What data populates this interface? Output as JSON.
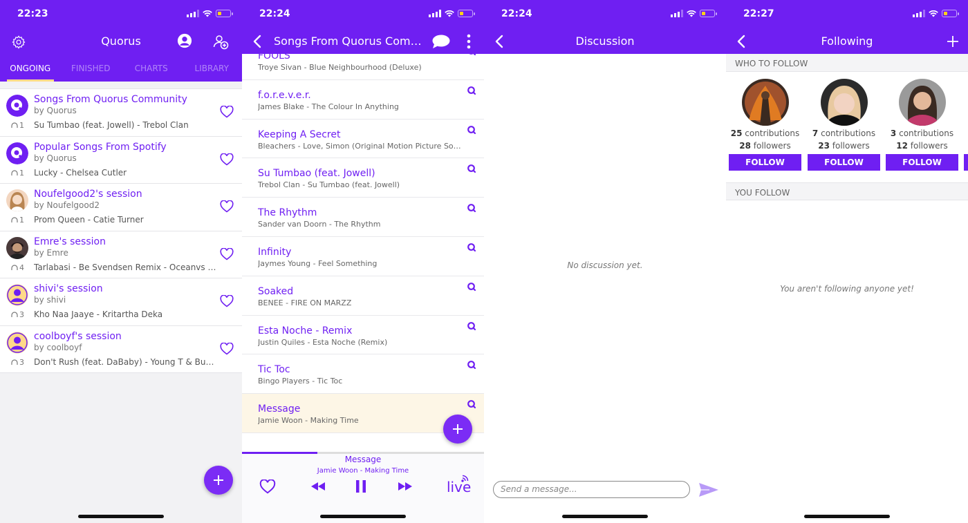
{
  "screens": {
    "quorus": {
      "time": "22:23",
      "title": "Quorus",
      "tabs": [
        "ONGOING",
        "FINISHED",
        "CHARTS",
        "LIBRARY"
      ],
      "sessions": [
        {
          "title": "Songs From Quorus Community",
          "by": "by Quorus",
          "listeners": "1",
          "track": "Su Tumbao (feat. Jowell) - Trebol Clan"
        },
        {
          "title": "Popular Songs From Spotify",
          "by": "by Quorus",
          "listeners": "1",
          "track": "Lucky - Chelsea Cutler"
        },
        {
          "title": "Noufelgood2's session",
          "by": "by Noufelgood2",
          "listeners": "1",
          "track": "Prom Queen - Catie Turner"
        },
        {
          "title": "Emre's session",
          "by": "by Emre",
          "listeners": "4",
          "track": "Tarlabasi - Be Svendsen Remix - Oceanvs Orientalis"
        },
        {
          "title": "shivi's session",
          "by": "by shivi",
          "listeners": "3",
          "track": "Kho Naa Jaaye - Kritartha Deka"
        },
        {
          "title": "coolboyf's session",
          "by": "by coolboyf",
          "listeners": "3",
          "track": "Don't Rush (feat. DaBaby) - Young T & Bugsey"
        }
      ]
    },
    "songs": {
      "time": "22:24",
      "title": "Songs From Quorus Comm...",
      "items": [
        {
          "name": "FOOLS",
          "artist": "Troye Sivan - Blue Neighbourhood (Deluxe)"
        },
        {
          "name": "f.o.r.e.v.e.r.",
          "artist": "James Blake - The Colour In Anything"
        },
        {
          "name": "Keeping A Secret",
          "artist": "Bleachers - Love, Simon (Original Motion Picture Soundtrack)"
        },
        {
          "name": "Su Tumbao (feat. Jowell)",
          "artist": "Trebol Clan - Su Tumbao (feat. Jowell)"
        },
        {
          "name": "The Rhythm",
          "artist": "Sander van Doorn - The Rhythm"
        },
        {
          "name": "Infinity",
          "artist": "Jaymes Young - Feel Something"
        },
        {
          "name": "Soaked",
          "artist": "BENEE - FIRE ON MARZZ"
        },
        {
          "name": "Esta Noche - Remix",
          "artist": "Justin Quiles - Esta Noche (Remix)"
        },
        {
          "name": "Tic Toc",
          "artist": "Bingo Players - Tic Toc"
        },
        {
          "name": "Message",
          "artist": "Jamie Woon - Making Time"
        }
      ],
      "now_playing": {
        "title": "Message",
        "artist": "Jamie Woon - Making Time",
        "progress": 0.31,
        "live_label": "live"
      }
    },
    "discussion": {
      "time": "22:24",
      "title": "Discussion",
      "empty_text": "No discussion yet.",
      "input_placeholder": "Send a message..."
    },
    "following": {
      "time": "22:27",
      "title": "Following",
      "who_to_follow": "WHO TO FOLLOW",
      "you_follow": "YOU FOLLOW",
      "empty_text": "You aren't following anyone yet!",
      "people": [
        {
          "contributions": "25",
          "contributions_label": "contributions",
          "followers": "28",
          "followers_label": "followers",
          "button": "FOLLOW"
        },
        {
          "contributions": "7",
          "contributions_label": "contributions",
          "followers": "23",
          "followers_label": "followers",
          "button": "FOLLOW"
        },
        {
          "contributions": "3",
          "contributions_label": "contributions",
          "followers": "12",
          "followers_label": "followers",
          "button": "FOLLOW"
        }
      ]
    }
  },
  "colors": {
    "brand": "#6f1ff2",
    "highlight": "#fdf6e6",
    "tab_indicator": "#ffd98a"
  }
}
